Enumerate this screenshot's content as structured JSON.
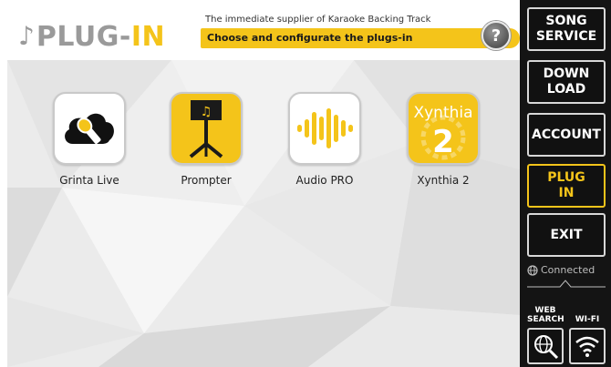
{
  "header": {
    "logo_note": "♪",
    "logo_plug": "PLUG-",
    "logo_in": "IN",
    "tagline": "The immediate supplier of Karaoke Backing Track",
    "subtitle": "Choose and configurate the plugs-in",
    "help_label": "?"
  },
  "plugins": [
    {
      "label": "Grinta Live",
      "icon": "cloud-microphone-icon",
      "bg": "#ffffff"
    },
    {
      "label": "Prompter",
      "icon": "music-stand-icon",
      "bg": "#f4c41a"
    },
    {
      "label": "Audio PRO",
      "icon": "audio-waveform-icon",
      "bg": "#ffffff"
    },
    {
      "label": "Xynthia 2",
      "icon": "xynthia-logo-icon",
      "bg": "#f4c41a",
      "icon_text": "Xynthia",
      "icon_number": "2"
    }
  ],
  "sidebar": {
    "song_service": "SONG\nSERVICE",
    "download": "DOWN\nLOAD",
    "account": "ACCOUNT",
    "plug_in": "PLUG\nIN",
    "exit": "EXIT",
    "status": "Connected",
    "web_search": "WEB\nSEARCH",
    "wifi": "WI-FI"
  },
  "colors": {
    "accent": "#f4c41a",
    "sidebar_bg": "#141414",
    "logo_gray": "#9a9a9a"
  }
}
